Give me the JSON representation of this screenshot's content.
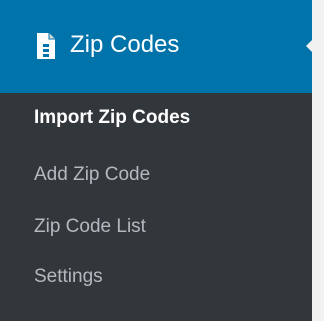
{
  "menu": {
    "title": "Zip Codes",
    "icon": "page-icon",
    "colors": {
      "sidebar_bg": "#23282d",
      "submenu_bg": "#32373c",
      "active_bg": "#0073aa",
      "item_text": "#b4b9be",
      "current_text": "#ffffff"
    },
    "items": [
      {
        "label": "Import Zip Codes",
        "current": true
      },
      {
        "label": "Add Zip Code",
        "current": false
      },
      {
        "label": "Zip Code List",
        "current": false
      },
      {
        "label": "Settings",
        "current": false
      }
    ]
  }
}
